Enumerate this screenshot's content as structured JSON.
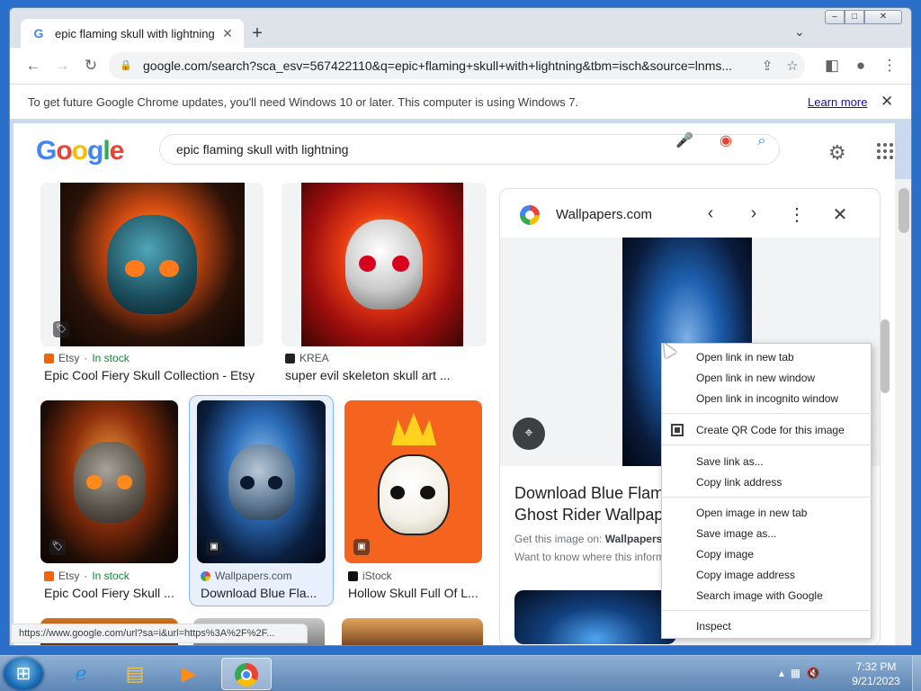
{
  "browser": {
    "tab": {
      "title": "epic flaming skull with lightning",
      "favicon": "google-g-icon"
    },
    "window_controls": {
      "minimize": "–",
      "maximize": "□",
      "close": "✕"
    },
    "toolbar": {
      "url": "google.com/search?sca_esv=567422110&q=epic+flaming+skull+with+lightning&tbm=isch&source=lnms..."
    },
    "infobar": {
      "message": "To get future Google Chrome updates, you'll need Windows 10 or later. This computer is using Windows 7.",
      "link": "Learn more"
    },
    "status_url": "https://www.google.com/url?sa=i&url=https%3A%2F%2F..."
  },
  "google": {
    "logo": {
      "G": "G",
      "o1": "o",
      "o2": "o",
      "g": "g",
      "l": "l",
      "e": "e"
    },
    "search_value": "epic flaming skull with lightning"
  },
  "results": [
    {
      "source": "Etsy",
      "stock": "In stock",
      "title": "Epic Cool Fiery Skull Collection - Etsy"
    },
    {
      "source": "KREA",
      "stock": "",
      "title": "super evil skeleton skull art ..."
    },
    {
      "source": "Etsy",
      "stock": "In stock",
      "title": "Epic Cool Fiery Skull ..."
    },
    {
      "source": "Wallpapers.com",
      "stock": "",
      "title": "Download Blue Fla..."
    },
    {
      "source": "iStock",
      "stock": "",
      "title": "Hollow Skull Full Of L..."
    }
  ],
  "panel": {
    "site": "Wallpapers.com",
    "title_line1": "Download Blue Flamin",
    "title_line2": "Ghost Rider Wallpape",
    "get_image_label": "Get this image on: ",
    "get_image_site": "Wallpapers.co",
    "want_to_know": "Want to know where this informa"
  },
  "context_menu": {
    "items": [
      "Open link in new tab",
      "Open link in new window",
      "Open link in incognito window",
      "Create QR Code for this image",
      "Save link as...",
      "Copy link address",
      "Open image in new tab",
      "Save image as...",
      "Copy image",
      "Copy image address",
      "Search image with Google",
      "Inspect"
    ]
  },
  "taskbar": {
    "time": "7:32 PM",
    "date": "9/21/2023"
  },
  "colors": {
    "google_blue": "#4285f4",
    "google_red": "#ea4335",
    "google_yellow": "#fbbc05",
    "google_green": "#34a853",
    "in_stock_green": "#188038"
  }
}
